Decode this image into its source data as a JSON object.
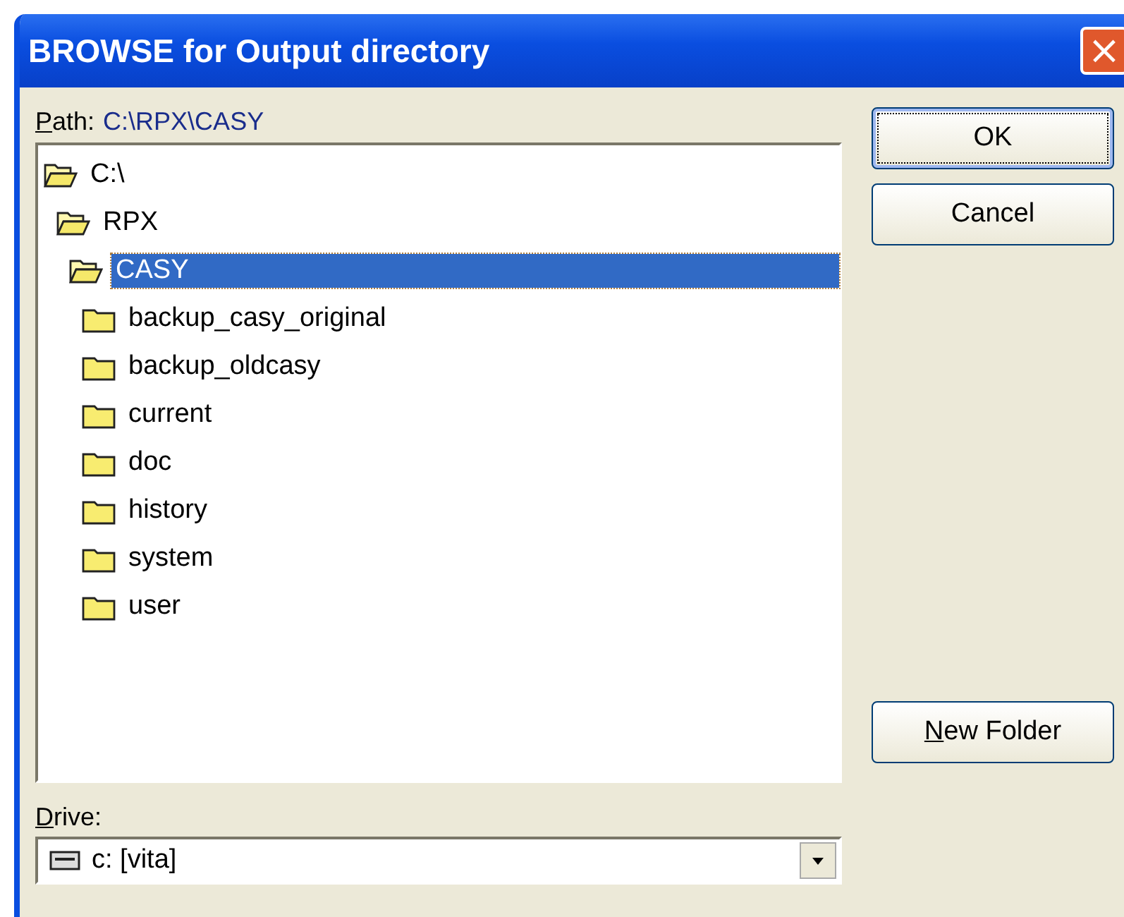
{
  "window": {
    "title": "BROWSE for Output directory",
    "close": "×"
  },
  "path": {
    "label": "Path:",
    "label_underline_first": true,
    "value": "C:\\RPX\\CASY"
  },
  "tree": [
    {
      "label": "C:\\",
      "expanded": true,
      "selected": false,
      "children": [
        {
          "label": "RPX",
          "expanded": true,
          "selected": false,
          "children": [
            {
              "label": "CASY",
              "expanded": true,
              "selected": true,
              "children": [
                {
                  "label": "backup_casy_original",
                  "expanded": false,
                  "selected": false
                },
                {
                  "label": "backup_oldcasy",
                  "expanded": false,
                  "selected": false
                },
                {
                  "label": "current",
                  "expanded": false,
                  "selected": false
                },
                {
                  "label": "doc",
                  "expanded": false,
                  "selected": false
                },
                {
                  "label": "history",
                  "expanded": false,
                  "selected": false
                },
                {
                  "label": "system",
                  "expanded": false,
                  "selected": false
                },
                {
                  "label": "user",
                  "expanded": false,
                  "selected": false
                }
              ]
            }
          ]
        }
      ]
    }
  ],
  "buttons": [
    {
      "label": "OK",
      "underline_first": false,
      "default": true
    },
    {
      "label": "Cancel",
      "underline_first": false,
      "default": false
    }
  ],
  "new_folder": {
    "label": "New Folder",
    "underline_first": true
  },
  "drive": {
    "label": "Drive:",
    "label_underline_first": true,
    "value": "c: [vita]"
  }
}
